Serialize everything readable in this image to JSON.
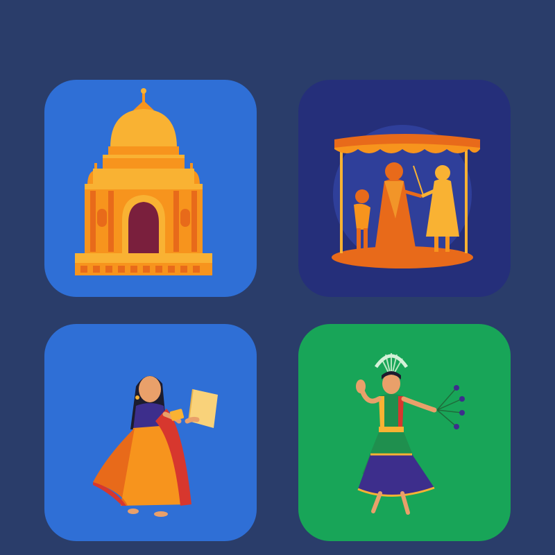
{
  "page": {
    "background": "#2a3d6a"
  },
  "tiles": [
    {
      "icon": "temple-icon",
      "background": "#2f6fd6"
    },
    {
      "icon": "puppet-show-icon",
      "background": "#252f7a"
    },
    {
      "icon": "woman-reading-icon",
      "background": "#2f6fd6"
    },
    {
      "icon": "peacock-dancer-icon",
      "background": "#18a558"
    }
  ],
  "palette": {
    "orange": "#f7941d",
    "dark_orange": "#e86a1a",
    "yellow": "#f9b233",
    "maroon": "#7a1f3d",
    "red": "#d7372e",
    "purple": "#3d2e8c",
    "green": "#1f8f4e",
    "gold": "#e9b44c"
  }
}
